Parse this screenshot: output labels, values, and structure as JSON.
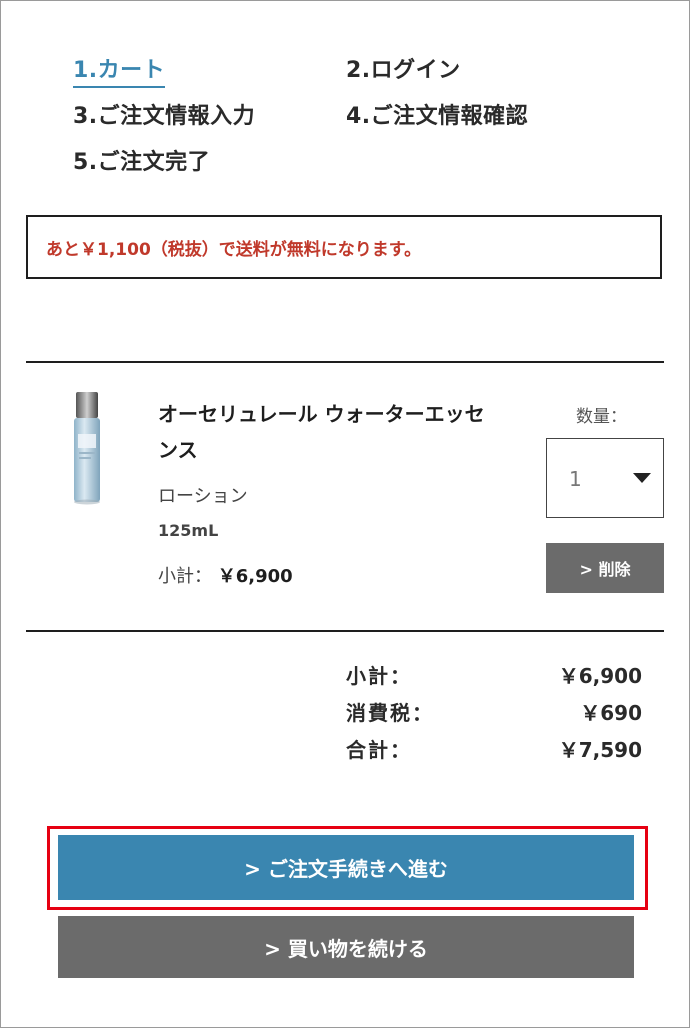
{
  "steps": {
    "s1": "1.カート",
    "s2": "2.ログイン",
    "s3": "3.ご注文情報入力",
    "s4": "4.ご注文情報確認",
    "s5": "5.ご注文完了"
  },
  "notice": "あと￥1,100（税抜）で送料が無料になります。",
  "product": {
    "name": "オーセリュレール ウォーターエッセンス",
    "category": "ローション",
    "size": "125mL",
    "subtotal_label": "小計：",
    "subtotal_value": "￥6,900",
    "image_icon": "lotion-bottle-icon"
  },
  "quantity": {
    "label": "数量：",
    "value": "1"
  },
  "delete_label": "> 削除",
  "summary": {
    "subtotal_label": "小計：",
    "subtotal_value": "￥6,900",
    "tax_label": "消費税：",
    "tax_value": "￥690",
    "total_label": "合計：",
    "total_value": "￥7,590"
  },
  "buttons": {
    "checkout": "> ご注文手続きへ進む",
    "continue": "> 買い物を続ける"
  },
  "colors": {
    "accent": "#3a86b0",
    "notice_text": "#c0392b",
    "secondary_button": "#6b6b6b",
    "highlight": "#e60012"
  }
}
